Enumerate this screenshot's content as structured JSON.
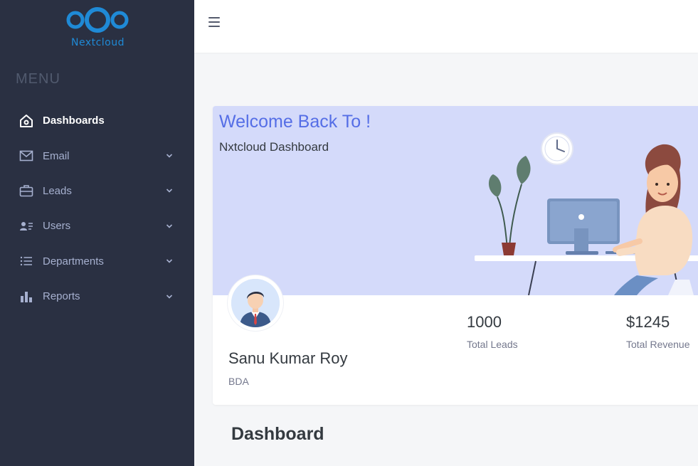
{
  "brand": {
    "name": "Nextcloud",
    "color": "#1f8ad6"
  },
  "sidebar": {
    "menu_title": "MENU",
    "items": [
      {
        "label": "Dashboards",
        "icon": "home-icon",
        "active": true,
        "has_submenu": false
      },
      {
        "label": "Email",
        "icon": "envelope-icon",
        "active": false,
        "has_submenu": true
      },
      {
        "label": "Leads",
        "icon": "briefcase-icon",
        "active": false,
        "has_submenu": true
      },
      {
        "label": "Users",
        "icon": "user-list-icon",
        "active": false,
        "has_submenu": true
      },
      {
        "label": "Departments",
        "icon": "list-icon",
        "active": false,
        "has_submenu": true
      },
      {
        "label": "Reports",
        "icon": "bar-chart-icon",
        "active": false,
        "has_submenu": true
      }
    ]
  },
  "topbar": {
    "menu_toggle_icon": "hamburger-icon"
  },
  "welcome_card": {
    "title": "Welcome Back To !",
    "subtitle": "Nxtcloud Dashboard",
    "user": {
      "name": "Sanu Kumar Roy",
      "role": "BDA"
    },
    "stats": [
      {
        "value": "1000",
        "label": "Total Leads"
      },
      {
        "value": "$1245",
        "label": "Total Revenue"
      }
    ]
  },
  "main": {
    "section_title": "Dashboard"
  },
  "colors": {
    "sidebar_bg": "#2a3042",
    "accent": "#556ee6",
    "banner_bg": "#d4dafa",
    "page_bg": "#f5f6f8"
  }
}
